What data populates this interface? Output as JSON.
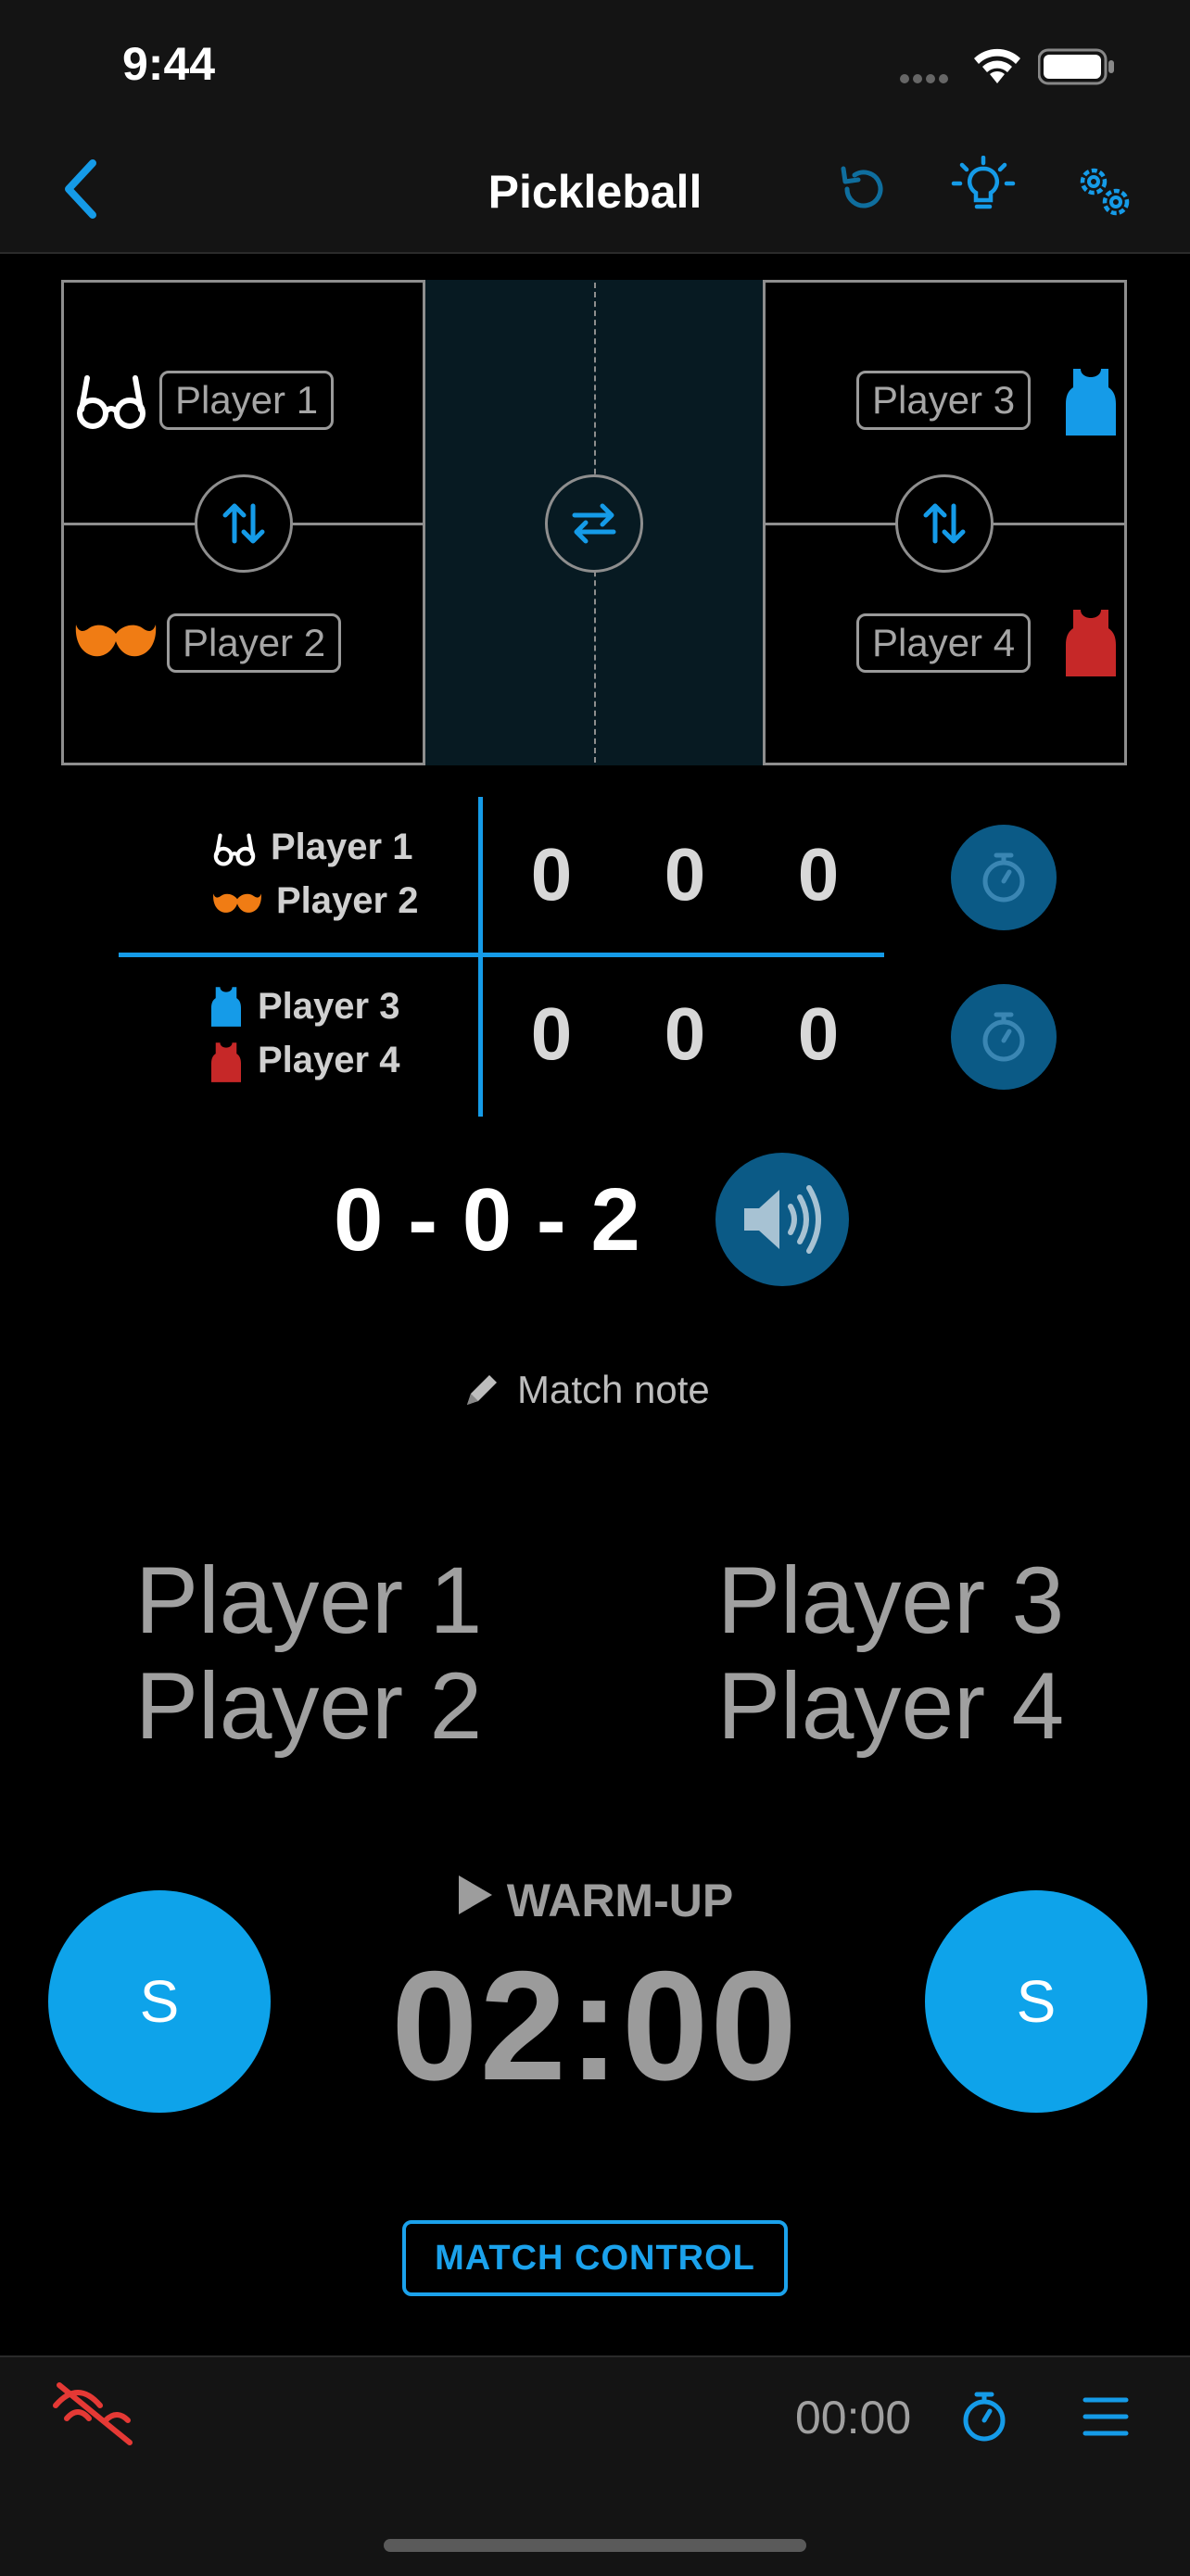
{
  "status_bar": {
    "time": "9:44"
  },
  "nav": {
    "title": "Pickleball"
  },
  "court": {
    "players": [
      {
        "name": "Player 1",
        "icon": "glasses-icon",
        "color": "#ffffff"
      },
      {
        "name": "Player 2",
        "icon": "mustache-icon",
        "color": "#f07c14"
      },
      {
        "name": "Player 3",
        "icon": "tank-top-icon",
        "color": "#159be8"
      },
      {
        "name": "Player 4",
        "icon": "tank-top-icon",
        "color": "#c62828"
      }
    ]
  },
  "scoreboard": {
    "team1": {
      "player_a": "Player 1",
      "player_b": "Player 2",
      "games": [
        "0",
        "0",
        "0"
      ]
    },
    "team2": {
      "player_a": "Player 3",
      "player_b": "Player 4",
      "games": [
        "0",
        "0",
        "0"
      ]
    },
    "call": "0 - 0 - 2"
  },
  "match_note": {
    "label": "Match note"
  },
  "teams_display": {
    "left": [
      "Player 1",
      "Player 2"
    ],
    "right": [
      "Player 3",
      "Player 4"
    ]
  },
  "serve_buttons": {
    "left_label": "S",
    "right_label": "S"
  },
  "timer": {
    "mode": "WARM-UP",
    "value": "02:00"
  },
  "match_control": {
    "label": "MATCH CONTROL"
  },
  "bottom_bar": {
    "elapsed": "00:00"
  },
  "colors": {
    "accent": "#159be8",
    "dark_accent": "#0b5a86",
    "muted_red": "#e53935"
  }
}
